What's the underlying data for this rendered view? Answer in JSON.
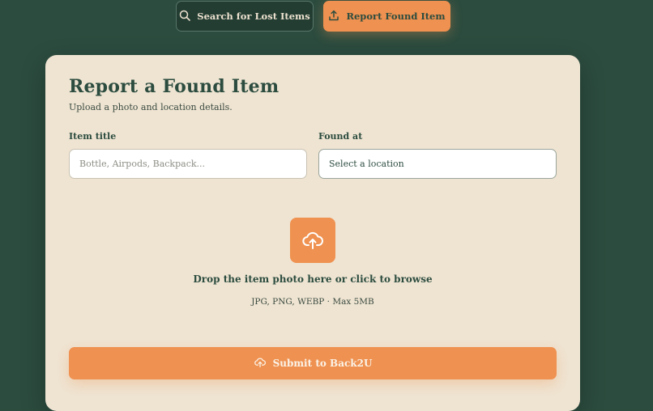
{
  "tabs": {
    "search_label": "Search for Lost Items",
    "report_label": "Report Found Item"
  },
  "form": {
    "title": "Report a Found Item",
    "subtitle": "Upload a photo and location details.",
    "item_title_label": "Item title",
    "item_title_placeholder": "Bottle, Airpods, Backpack...",
    "found_at_label": "Found at",
    "found_at_value": "Select a location"
  },
  "upload": {
    "title": "Drop the item photo here or click to browse",
    "hint": "JPG, PNG, WEBP · Max 5MB",
    "icon": "cloud-upload-icon"
  },
  "submit": {
    "label": "Submit to Back2U",
    "icon": "cloud-upload-icon"
  },
  "colors": {
    "background": "#2c4c3f",
    "card": "#efe4d2",
    "accent": "#ef9150",
    "text": "#2c4c3f"
  }
}
